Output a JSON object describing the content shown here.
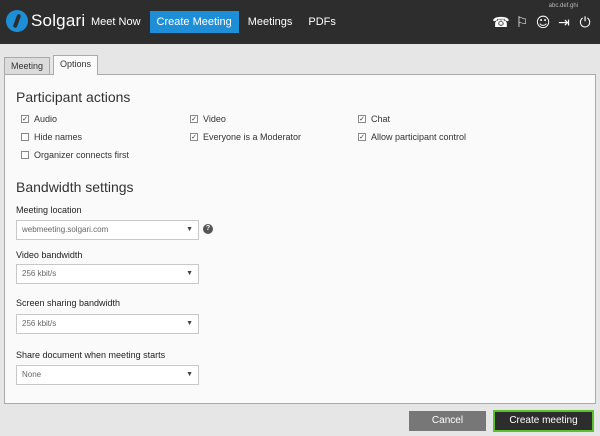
{
  "app": {
    "brand": "Solgari",
    "user_name": "abc.def.ghi"
  },
  "nav": {
    "items": [
      {
        "label": "Meet Now",
        "active": false
      },
      {
        "label": "Create Meeting",
        "active": true
      },
      {
        "label": "Meetings",
        "active": false
      },
      {
        "label": "PDFs",
        "active": false
      }
    ]
  },
  "top_icons": [
    "phone-book-icon",
    "presentation-icon",
    "contacts-icon",
    "exit-icon",
    "power-icon"
  ],
  "tabs": [
    {
      "label": "Meeting",
      "active": false
    },
    {
      "label": "Options",
      "active": true
    }
  ],
  "participant_actions": {
    "title": "Participant actions",
    "options": [
      {
        "label": "Audio",
        "checked": true
      },
      {
        "label": "Video",
        "checked": true
      },
      {
        "label": "Chat",
        "checked": true
      },
      {
        "label": "Hide names",
        "checked": false
      },
      {
        "label": "Everyone is a Moderator",
        "checked": true
      },
      {
        "label": "Allow participant control",
        "checked": true
      },
      {
        "label": "Organizer connects first",
        "checked": false
      }
    ]
  },
  "bandwidth": {
    "title": "Bandwidth settings",
    "meeting_location": {
      "label": "Meeting location",
      "value": "webmeeting.solgari.com"
    },
    "video_bandwidth": {
      "label": "Video bandwidth",
      "value": "256 kbit/s"
    },
    "screen_bandwidth": {
      "label": "Screen sharing bandwidth",
      "value": "256 kbit/s"
    },
    "share_document": {
      "label": "Share document when meeting starts",
      "value": "None"
    }
  },
  "buttons": {
    "cancel": "Cancel",
    "create": "Create meeting"
  },
  "colors": {
    "topbar": "#2d2d2d",
    "accent": "#1e8fd6",
    "create_border": "#5cc02e"
  }
}
